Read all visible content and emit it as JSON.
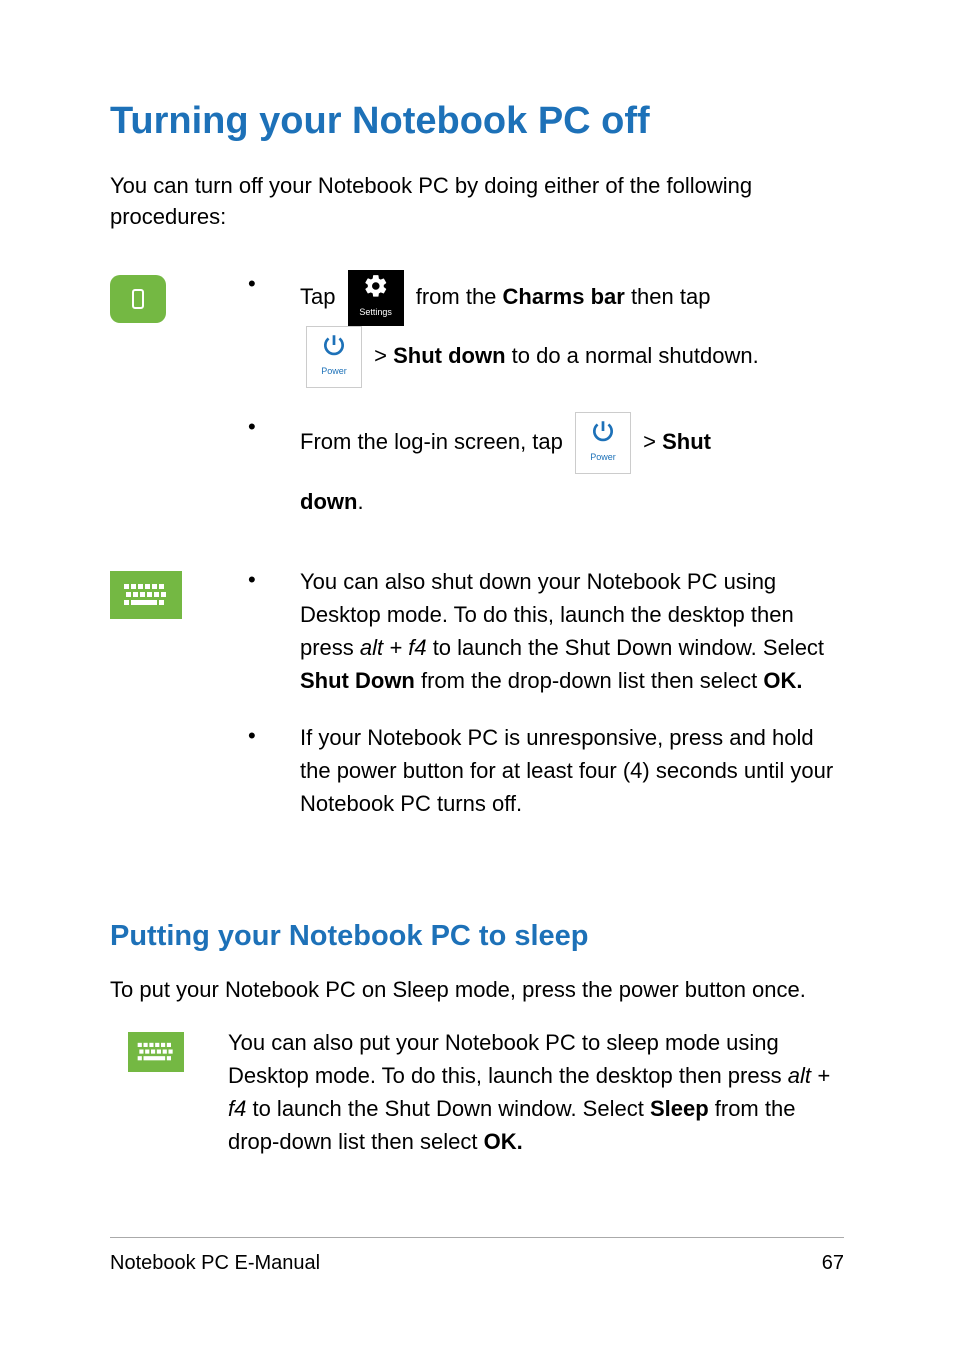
{
  "heading1": "Turning your Notebook PC off",
  "intro": "You can turn off your Notebook PC by doing either of the following procedures:",
  "touch": {
    "bullet1": {
      "pre": "Tap ",
      "mid": " from  the ",
      "charms": "Charms bar",
      "post": " then tap "
    },
    "bullet1b": {
      "gt": " > ",
      "shutdown": "Shut down",
      "post": " to do a normal shutdown."
    },
    "bullet2": {
      "pre": "From the log-in screen, tap ",
      "gt": " > ",
      "shut": "Shut ",
      "down": "down",
      "period": "."
    }
  },
  "keyboard": {
    "bullet1": {
      "t1": "You can also shut down your Notebook PC using Desktop mode. To do this, launch the desktop then press ",
      "kbd": "alt + f4",
      "t2": " to launch the Shut Down window. Select ",
      "b1": "Shut Down",
      "t3": " from the drop-down list then select ",
      "b2": "OK."
    },
    "bullet2": "If your Notebook PC is unresponsive, press and hold the power button for at least four (4) seconds until your Notebook PC turns off."
  },
  "heading2": "Putting your Notebook PC to sleep",
  "sleep_intro": "To put your Notebook PC on Sleep mode, press the power button once.",
  "sleep_note": {
    "t1": "You can also put your Notebook PC to sleep mode using Desktop mode. To do this, launch the desktop then press ",
    "kbd": "alt + f4",
    "t2": " to launch the Shut Down window. Select ",
    "b1": "Sleep",
    "t3": " from the drop-down list then select ",
    "b2": "OK."
  },
  "icons": {
    "settings_label": "Settings",
    "power_label": "Power"
  },
  "footer": {
    "title": "Notebook PC E-Manual",
    "page": "67"
  }
}
